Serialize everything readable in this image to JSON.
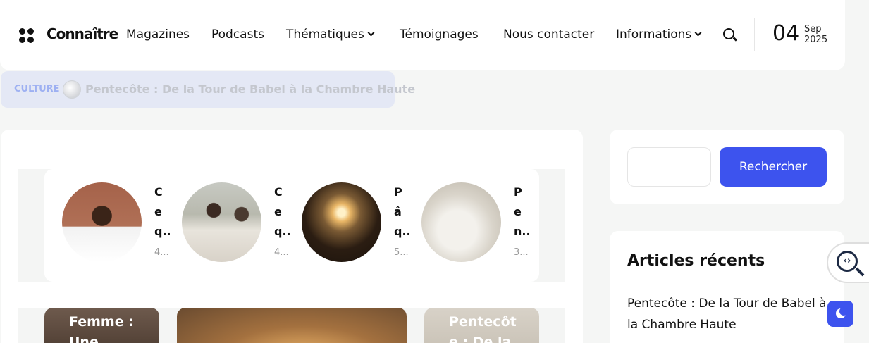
{
  "header": {
    "logo": "Connaître",
    "nav": [
      {
        "label": "Magazines",
        "dropdown": false
      },
      {
        "label": "Podcasts",
        "dropdown": false
      },
      {
        "label": "Thématiques",
        "dropdown": true
      },
      {
        "label": "Témoignages",
        "dropdown": false
      },
      {
        "label": "Nous contacter",
        "dropdown": false
      },
      {
        "label": "Informations",
        "dropdown": true
      }
    ],
    "date": {
      "day": "04",
      "month": "Sep",
      "year": "2025"
    }
  },
  "ticker": {
    "category": "CULTURE",
    "title": "Pentecôte : De la Tour de Babel à la Chambre Haute"
  },
  "slider": {
    "items": [
      {
        "letters": [
          "C",
          "e",
          "q.."
        ],
        "meta": "4..."
      },
      {
        "letters": [
          "C",
          "e",
          "q.."
        ],
        "meta": "4..."
      },
      {
        "letters": [
          "P",
          "â",
          "q.."
        ],
        "meta": "5..."
      },
      {
        "letters": [
          "P",
          "e",
          "n.."
        ],
        "meta": "3..."
      }
    ]
  },
  "posts": [
    {
      "title": "Femme : Une"
    },
    {
      "title": ""
    },
    {
      "title": "Pentecôt e : De la"
    }
  ],
  "sidebar": {
    "search_button": "Rechercher",
    "search_placeholder": "",
    "recent_heading": "Articles récents",
    "recent_articles": [
      "Pentecôte : De la Tour de Babel à la Chambre Haute"
    ]
  },
  "colors": {
    "accent": "#3d53ee",
    "ticker_bg": "#e4e8f5",
    "page_bg": "#f5f6f5"
  }
}
